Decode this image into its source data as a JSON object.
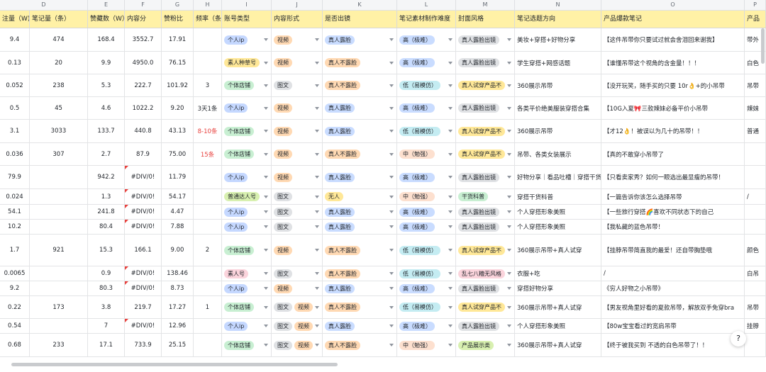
{
  "columns": {
    "letters": [
      "D",
      "E",
      "F",
      "G",
      "H",
      "I",
      "J",
      "K",
      "L",
      "M",
      "N",
      "O",
      "P"
    ],
    "titles": [
      "注量（W)",
      "笔记量（条）",
      "赞藏数（W）",
      "内容分",
      "赞粉比",
      "频率（条/",
      "账号类型",
      "内容形式",
      "是否出镜",
      "笔记素材制作难度",
      "封面风格",
      "笔记选题方向",
      "产品爆款笔记",
      "产品"
    ]
  },
  "rows": [
    {
      "d": "9.4",
      "e": "474",
      "f": "168.4",
      "g": "3552.7",
      "h": "17.91",
      "i": "",
      "j": "个人ip",
      "k": [
        "视频"
      ],
      "l": "真人露脸",
      "m": "高（极难）",
      "n": "真人露脸出镜",
      "o": "美妆+穿搭+好物分享",
      "p": "【这件吊带你只要试过就会舍泪回来谢我】",
      "q": "带外"
    },
    {
      "d": "0.13",
      "e": "20",
      "f": "9.9",
      "g": "4950.0",
      "h": "76.15",
      "i": "",
      "j": "素人种草号",
      "k": [
        "视频"
      ],
      "l": "真人不露脸",
      "m": "高（极难）",
      "n": "真人露脸出镜",
      "o": "学生穿搭+网感话题",
      "p": "【谁懂吊带这个视角的含金量！！！",
      "q": "白色"
    },
    {
      "d": "0.052",
      "e": "238",
      "f": "5.3",
      "g": "222.7",
      "h": "101.92",
      "i": "3",
      "j": "个体店铺",
      "k": [
        "图文"
      ],
      "l": "真人不露脸",
      "m": "低（易模仿）",
      "n": "真人试穿产品不",
      "o": "360展示吊带",
      "p": "【没开玩笑，随手买的只要 10r👌+的小吊带",
      "q": "吊带"
    },
    {
      "d": "0.5",
      "e": "45",
      "f": "4.6",
      "g": "1022.2",
      "h": "9.20",
      "i": "3天1条",
      "j": "个人ip",
      "k": [
        "视频"
      ],
      "l": "真人露脸",
      "m": "高（极难）",
      "n": "真人露脸出镜",
      "o": "各类平价绝美服装穿搭合集",
      "p": "【10G入夏🎀三款辣妹必备平价小吊带",
      "q": "辣妹"
    },
    {
      "d": "3.1",
      "e": "3033",
      "f": "133.7",
      "g": "440.8",
      "h": "43.13",
      "i": "8-10条",
      "j": "个体店铺",
      "k": [
        "视频"
      ],
      "l": "真人露脸",
      "m": "低（易模仿）",
      "n": "真人试穿产品不",
      "o": "360展示吊带",
      "p": "【才12👌！被误以为几十的吊带！！",
      "q": "普通"
    },
    {
      "d": "0.036",
      "e": "307",
      "f": "2.7",
      "g": "87.9",
      "h": "75.00",
      "i": "15条",
      "j": "个体店铺",
      "k": [
        "视频"
      ],
      "l": "真人不露脸",
      "m": "中（勉强）",
      "n": "真人试穿产品不",
      "o": "吊带、各类女装展示",
      "p": "【真的不敢穿小吊带了",
      "q": ""
    },
    {
      "d": "79.9",
      "e": "",
      "f": "942.2",
      "g": "#DIV/0!",
      "h": "11.79",
      "i": "",
      "j": "个人ip",
      "k": [
        "视频"
      ],
      "l": "真人露脸",
      "m": "高（极难）",
      "n": "真人露脸出镜",
      "o": "好物分享｜看品吐槽｜穿搭干货",
      "p": "【只看卖家秀？如何一眼选出最显瘦的吊带！",
      "q": ""
    },
    {
      "d": "0.024",
      "e": "",
      "f": "1.3",
      "g": "#DIV/0!",
      "h": "54.17",
      "i": "",
      "j": "普通达人号",
      "k": [
        "图文"
      ],
      "l": "无人",
      "m": "中（勉强）",
      "n": "干货科普",
      "o": "穿搭干货科普",
      "p": "【一篇告诉你该怎么选择吊带",
      "q": "/"
    },
    {
      "d": "54.1",
      "e": "",
      "f": "241.8",
      "g": "#DIV/0!",
      "h": "4.47",
      "i": "",
      "j": "个人ip",
      "k": [
        "图文"
      ],
      "l": "真人露脸",
      "m": "高（极难）",
      "n": "真人露脸出镜",
      "o": "个人穿搭形象美照",
      "p": "【一些旅行穿搭🌈喜欢不同状态下的自己",
      "q": ""
    },
    {
      "d": "10.2",
      "e": "",
      "f": "80.4",
      "g": "#DIV/0!",
      "h": "7.88",
      "i": "",
      "j": "个人ip",
      "k": [
        "图文"
      ],
      "l": "真人露脸",
      "m": "高（极难）",
      "n": "真人露脸出镜",
      "o": "个人穿搭形象美照",
      "p": "【我私藏的蓝色吊带！",
      "q": ""
    },
    {
      "d": "1.7",
      "e": "921",
      "f": "15.3",
      "g": "166.1",
      "h": "9.00",
      "i": "2",
      "j": "个体店铺",
      "k": [
        "视频"
      ],
      "l": "真人不露脸",
      "m": "低（易模仿）",
      "n": "真人试穿产品不",
      "o": "360展示吊带+真人试穿",
      "p": "【挂脖吊带简直我的最爱！还自带胸垫哦",
      "q": "颜色"
    },
    {
      "d": "0.0065",
      "e": "",
      "f": "0.9",
      "g": "#DIV/0!",
      "h": "138.46",
      "i": "",
      "j": "素人号",
      "k": [
        "图文"
      ],
      "l": "真人不露脸",
      "m": "低（易模仿）",
      "n": "乱七八糟无风格",
      "o": "衣服+吃",
      "p": "/",
      "q": "白吊"
    },
    {
      "d": "9.2",
      "e": "",
      "f": "80.3",
      "g": "#DIV/0!",
      "h": "8.73",
      "i": "",
      "j": "个人ip",
      "k": [
        "视频"
      ],
      "l": "真人露脸",
      "m": "高（极难）",
      "n": "真人露脸出镜",
      "o": "穿搭好物分享",
      "p": "《穷人好物之小吊带》",
      "q": ""
    },
    {
      "d": "0.22",
      "e": "173",
      "f": "3.8",
      "g": "219.7",
      "h": "17.27",
      "i": "1",
      "j": "个体店铺",
      "k": [
        "图文",
        "视频"
      ],
      "l": "真人不露脸",
      "m": "低（易模仿）",
      "n": "真人试穿产品不",
      "o": "360展示吊带+真人试穿",
      "p": "【男友视角里好看的夏款吊带，解放双手免穿bra",
      "q": "吊带"
    },
    {
      "d": "0.54",
      "e": "",
      "f": "7",
      "g": "#DIV/0!",
      "h": "12.96",
      "i": "",
      "j": "个人ip",
      "k": [
        "图文",
        "视频"
      ],
      "l": "真人露脸",
      "m": "高（极难）",
      "n": "真人露脸出镜",
      "o": "个人穿搭形象美照",
      "p": "【80w宝宝看过的宽肩吊带",
      "q": "挂脖"
    },
    {
      "d": "0.68",
      "e": "233",
      "f": "17.1",
      "g": "733.9",
      "h": "25.15",
      "i": "",
      "j": "个体店铺",
      "k": [
        "图文",
        "视频"
      ],
      "l": "真人不露脸",
      "m": "中（勉强）",
      "n": "产品展示类",
      "o": "360展示吊带+真人试穿",
      "p": "【终于被我买到 不透的白色吊带了！！",
      "q": ""
    }
  ],
  "tag_colors": {
    "account": {
      "个人ip": "blue",
      "素人种草号": "yellow",
      "个体店铺": "green",
      "普通达人号": "lime",
      "素人号": "pink"
    },
    "form": {
      "视频": "orange",
      "图文": "gray"
    },
    "face": {
      "真人露脸": "lblue",
      "真人不露脸": "orange",
      "无人": "yellow"
    },
    "difficulty": {
      "高（极难）": "lblue",
      "低（易模仿）": "cyan",
      "中（勉强）": "peach"
    },
    "cover": {
      "真人露脸出镜": "gray",
      "真人试穿产品不": "yellow",
      "干货科普": "green",
      "乱七八糟无风格": "pink",
      "产品展示类": "lime"
    }
  },
  "help_label": "?"
}
